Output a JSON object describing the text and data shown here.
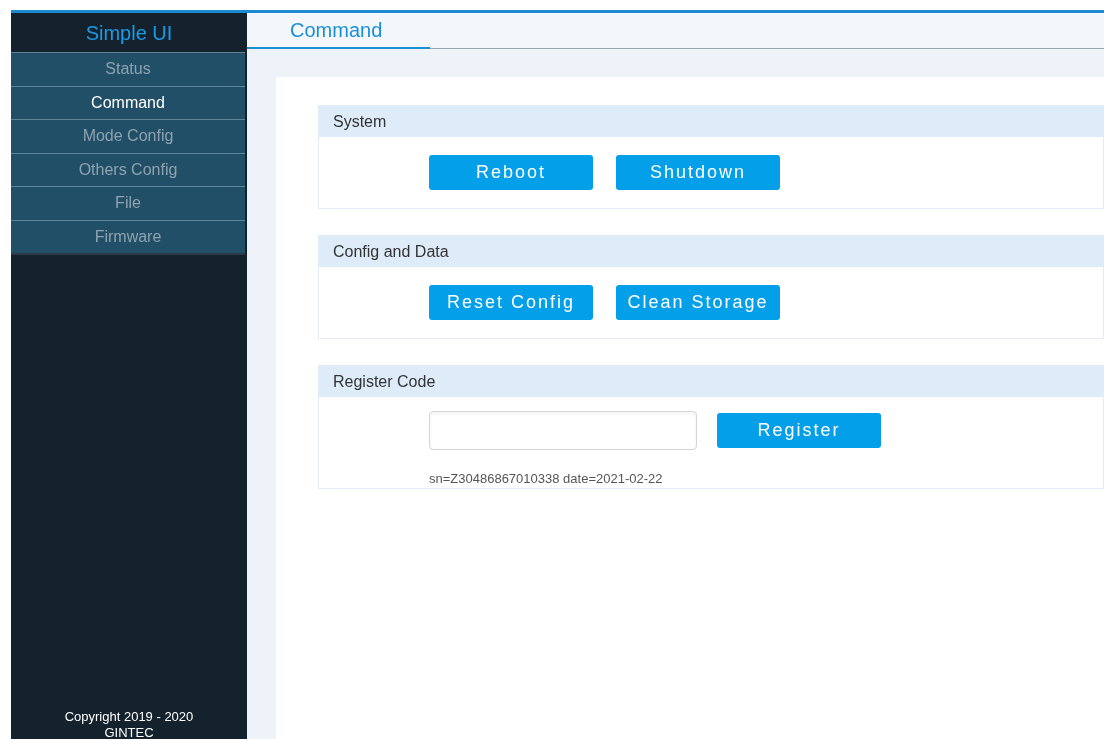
{
  "sidebar": {
    "title": "Simple UI",
    "items": [
      {
        "label": "Status",
        "selected": false
      },
      {
        "label": "Command",
        "selected": true
      },
      {
        "label": "Mode Config",
        "selected": false
      },
      {
        "label": "Others Config",
        "selected": false
      },
      {
        "label": "File",
        "selected": false
      },
      {
        "label": "Firmware",
        "selected": false
      }
    ],
    "footer": [
      "Copyright 2019 - 2020",
      "GINTEC"
    ]
  },
  "tab": {
    "label": "Command",
    "selected": true
  },
  "sections": [
    {
      "kind": "buttons",
      "title": "System",
      "buttons": [
        "Reboot",
        "Shutdown"
      ]
    },
    {
      "kind": "buttons",
      "title": "Config and Data",
      "buttons": [
        "Reset Config",
        "Clean Storage"
      ]
    },
    {
      "kind": "register",
      "title": "Register Code",
      "button": "Register",
      "info": "sn=Z30486867010338 date=2021-02-22"
    }
  ]
}
